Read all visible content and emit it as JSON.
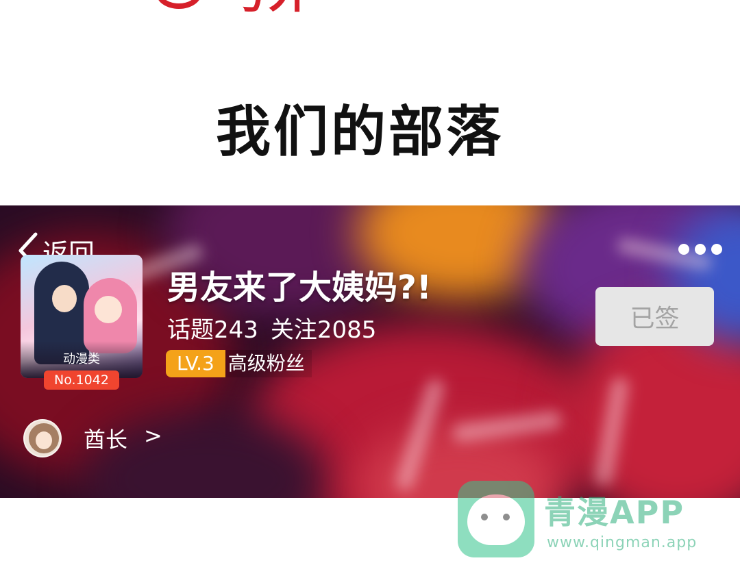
{
  "header_logo": {
    "text": "号外"
  },
  "page_title": "我们的部落",
  "banner": {
    "back_label": "返回",
    "title": "男友来了大姨妈?!",
    "stats": {
      "topics": "话题243",
      "followers": "关注2085"
    },
    "level": {
      "badge": "LV.3",
      "name": "高级粉丝"
    },
    "cover": {
      "category": "动漫类",
      "rank": "No.1042"
    },
    "signed_button": "已签",
    "owner": {
      "label": "酋长",
      "arrow": ">"
    }
  },
  "watermark": {
    "name": "青漫APP",
    "url": "www.qingman.app"
  }
}
